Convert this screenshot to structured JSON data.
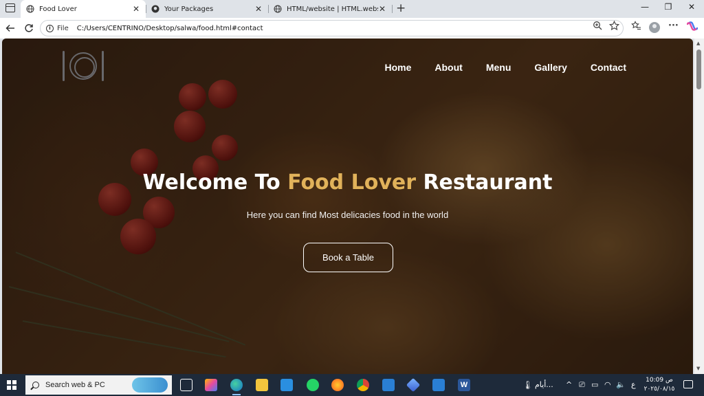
{
  "browser": {
    "tabs": [
      {
        "title": "Food Lover",
        "active": true,
        "icon": "globe-icon"
      },
      {
        "title": "Your Packages",
        "active": false,
        "icon": "github-icon"
      },
      {
        "title": "HTML/website | HTML.website",
        "active": false,
        "icon": "globe-icon"
      }
    ],
    "close_glyph": "✕",
    "new_tab_glyph": "+",
    "window_controls": {
      "minimize": "—",
      "maximize": "❐",
      "close": "✕"
    },
    "address": {
      "scheme_label": "File",
      "url": "C:/Users/CENTRINO/Desktop/salwa/food.html#contact"
    }
  },
  "site": {
    "nav": [
      "Home",
      "About",
      "Menu",
      "Gallery",
      "Contact"
    ],
    "hero": {
      "title_before": "Welcome To ",
      "title_accent": "Food Lover",
      "title_after": " Restaurant",
      "subtitle": "Here you can find Most delicacies food in the world",
      "cta": "Book a Table"
    },
    "accent_color": "#e1b25a"
  },
  "taskbar": {
    "search_placeholder": "Search web & PC",
    "weather_text": "أيام...",
    "lang": "ع",
    "time": "10:09 ص",
    "date": "٢٠٢٥/٠٨/١٥"
  }
}
